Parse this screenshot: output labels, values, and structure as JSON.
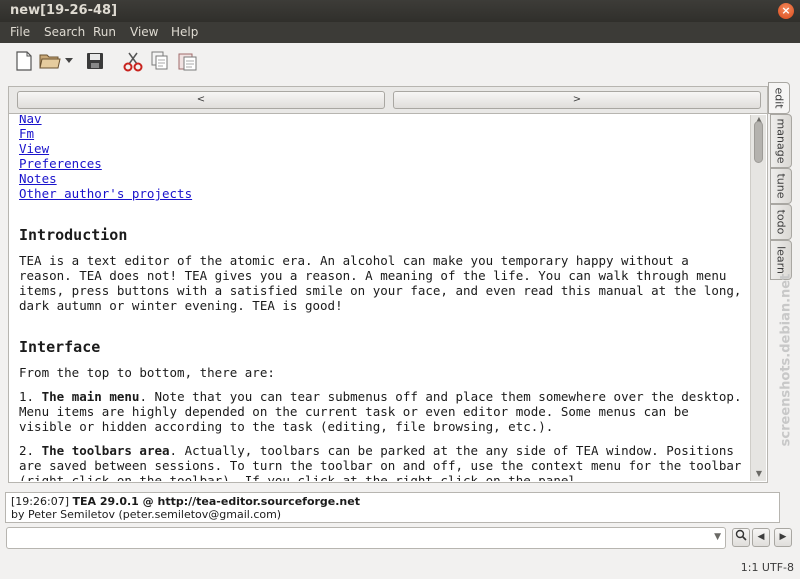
{
  "window": {
    "title": "new[19-26-48]"
  },
  "menu": [
    "File",
    "Search",
    "Run",
    "View",
    "Help"
  ],
  "toolbar": {
    "icons": [
      "new-file-icon",
      "open-file-icon",
      "open-dropdown-icon",
      "save-icon",
      "cut-icon",
      "copy-icon",
      "paste-icon"
    ]
  },
  "nav": {
    "prev": "<",
    "next": ">"
  },
  "doc": {
    "links": [
      "Nav",
      "Fm",
      "View",
      "Preferences",
      "Notes",
      "Other author's projects"
    ],
    "intro_heading": "Introduction",
    "intro_text": "TEA is a text editor of the atomic era. An alcohol can make you temporary happy without a reason. TEA does not! TEA gives you a reason. A meaning of the life. You can walk through menu items, press buttons with a satisfied smile on your face, and even read this manual at the long, dark autumn or winter evening. TEA is good!",
    "interface_heading": "Interface",
    "interface_intro": "From the top to bottom, there are:",
    "item1_num": "1.",
    "item1_bold": "The main menu",
    "item1_text": ". Note that you can tear submenus off and place them somewhere over the desktop. Menu items are highly depended on the current task or even editor mode. Some menus can be visible or hidden according to the task (editing, file browsing, etc.).",
    "item2_num": "2.",
    "item2_bold": "The toolbars area",
    "item2_text": ". Actually, toolbars can be parked at the any side of TEA window. Positions are saved between sessions. To turn the toolbar on and off, use the context menu for the toolbar (right-click on the toolbar). If you click at the right click on the panel"
  },
  "sidetabs": [
    "edit",
    "manage",
    "tune",
    "todo",
    "learn"
  ],
  "watermark": "screenshots.debian.net",
  "log": {
    "time": "[19:26:07]",
    "app": "TEA 29.0.1 @ http://tea-editor.sourceforge.net",
    "author": "by Peter Semiletov (peter.semiletov@gmail.com)"
  },
  "command": {
    "value": ""
  },
  "status": {
    "text": "1:1 UTF-8"
  }
}
